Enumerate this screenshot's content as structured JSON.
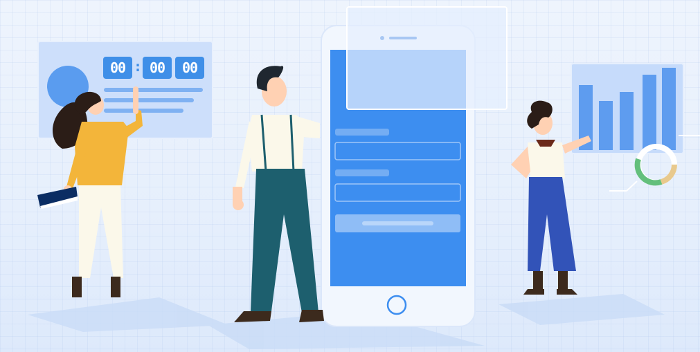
{
  "timer": {
    "hours": "00",
    "minutes": "00",
    "seconds": "00",
    "separator": ":"
  },
  "colors": {
    "background": "#eaf2fd",
    "accent": "#3f8fe8",
    "phone_screen": "#3d8ef0",
    "panel": "#cfe0fb",
    "woman_top": "#f3b53a",
    "man_pants": "#1d5f6e",
    "woman_pants": "#3253b8"
  },
  "icons": {
    "donut_chart": "donut-chart-icon",
    "bar_chart": "bar-chart-icon",
    "phone_home_button": "home-button-icon"
  }
}
